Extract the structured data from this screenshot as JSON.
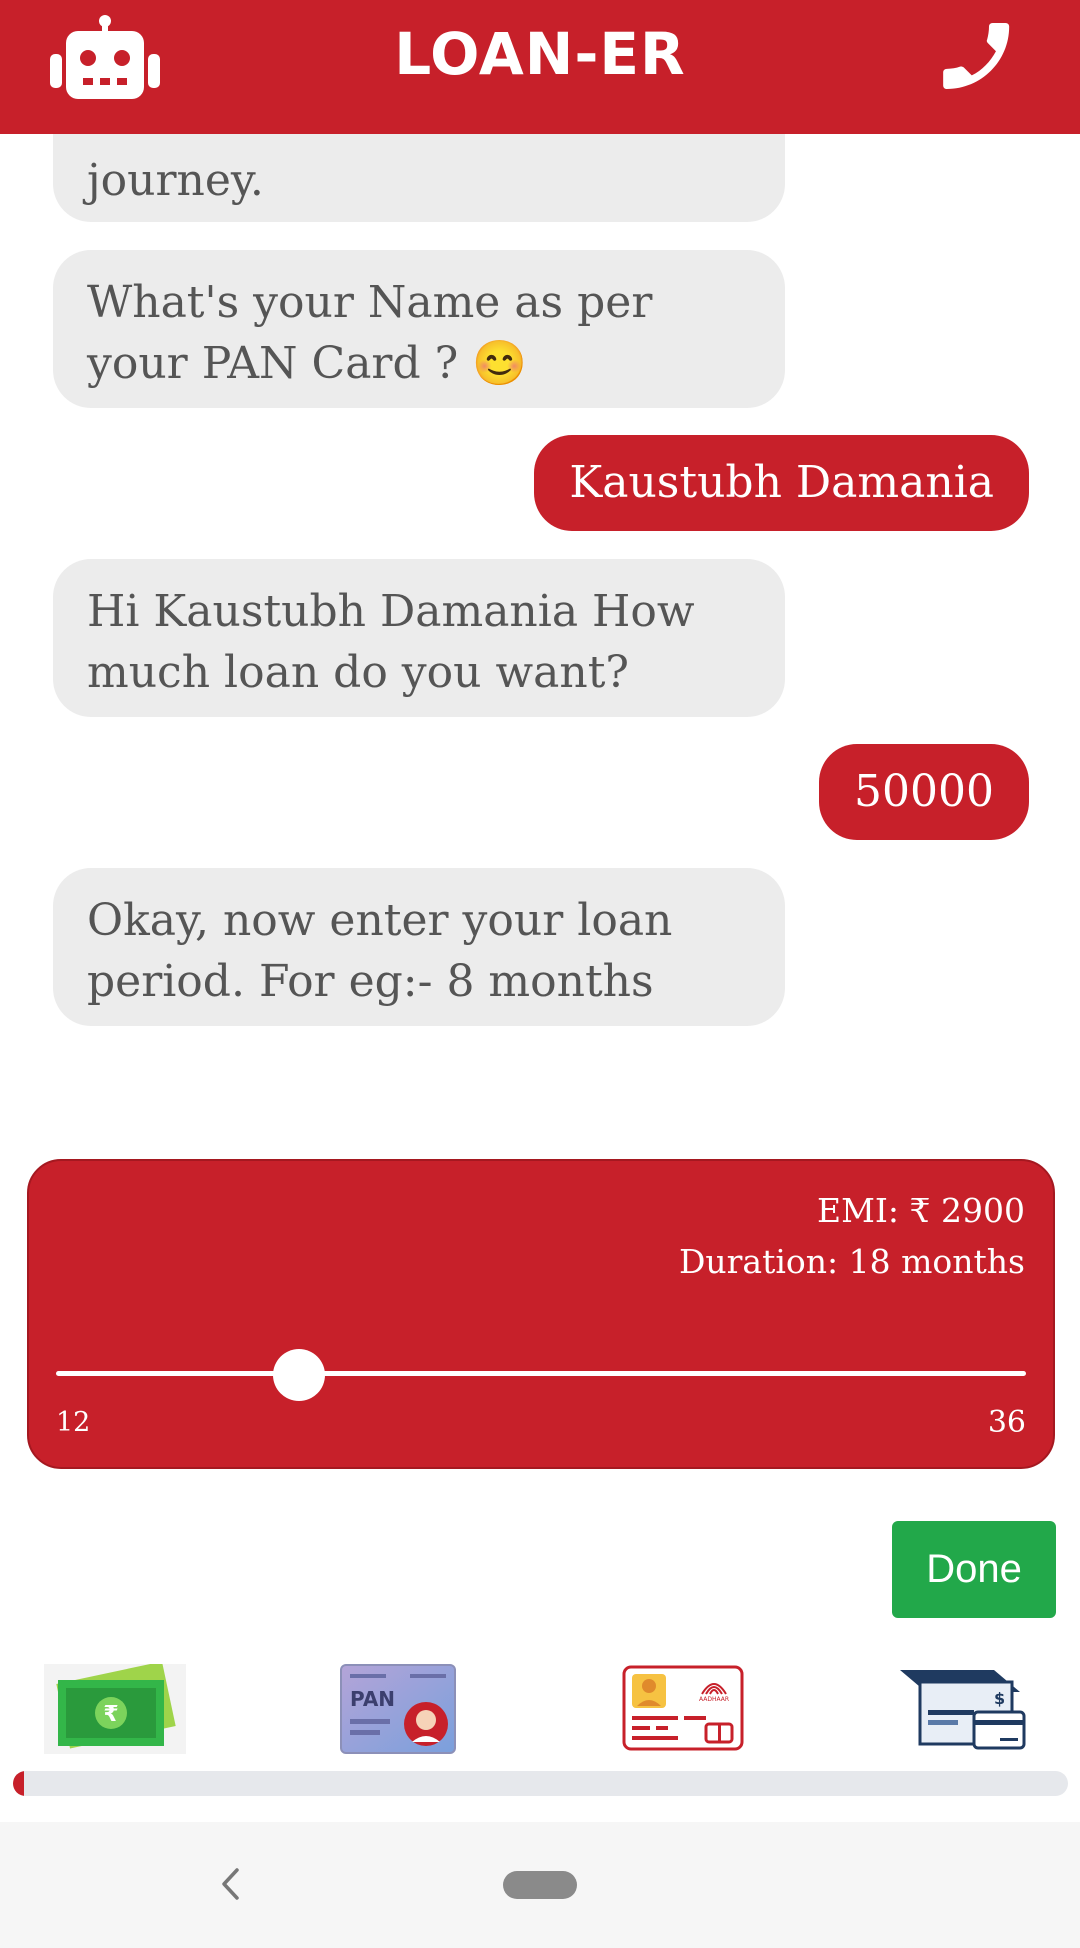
{
  "header": {
    "title": "LOAN-ER",
    "left_icon": "robot-icon",
    "right_icon": "phone-icon",
    "color": "#c7202a"
  },
  "chat": {
    "messages": [
      {
        "sender": "bot",
        "text": "journey."
      },
      {
        "sender": "bot",
        "text": "What's your Name as per your PAN Card ? 😊"
      },
      {
        "sender": "user",
        "text": "Kaustubh Damania"
      },
      {
        "sender": "bot",
        "text": "Hi Kaustubh Damania How much loan do you want?"
      },
      {
        "sender": "user",
        "text": "50000"
      },
      {
        "sender": "bot",
        "text": "Okay, now enter your loan period. For eg:- 8 months"
      }
    ]
  },
  "loan_slider": {
    "emi_text": "EMI: ₹ 2900",
    "duration_text": "Duration: 18 months",
    "min_label": "12",
    "max_label": "36",
    "min": 12,
    "max": 36,
    "value": 18
  },
  "done_button": {
    "label": "Done",
    "color": "#22a84a"
  },
  "documents": [
    {
      "name": "money-icon"
    },
    {
      "name": "pan-card-icon",
      "label": "PAN"
    },
    {
      "name": "aadhaar-card-icon",
      "label": "AADHAAR"
    },
    {
      "name": "bank-cheque-icon"
    }
  ],
  "progress": {
    "percent": 1
  },
  "navbar": {
    "back_icon": "chevron-left-icon",
    "home_icon": "home-pill"
  }
}
